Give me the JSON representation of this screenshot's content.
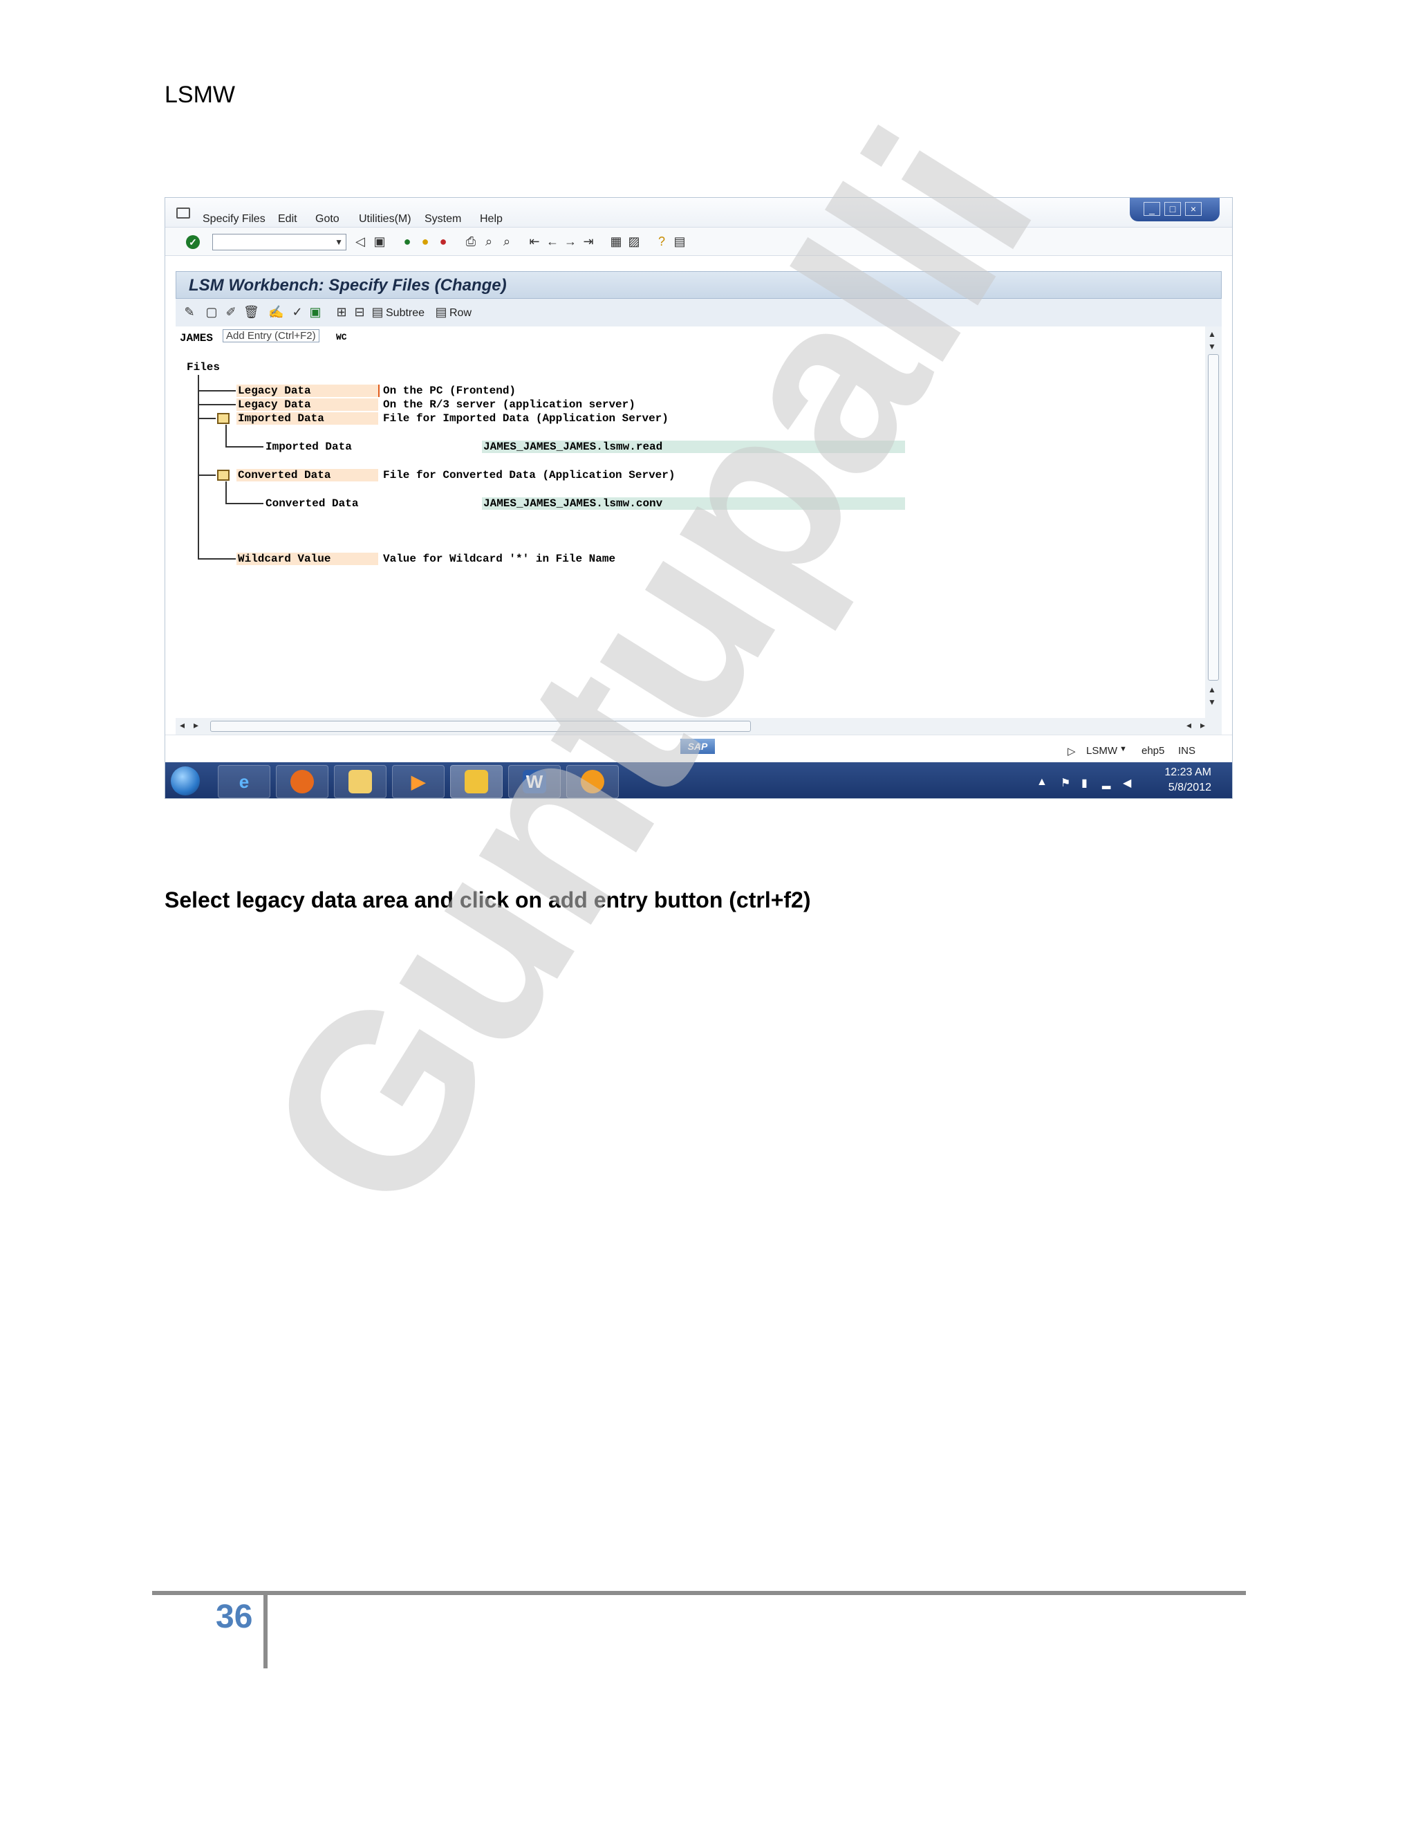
{
  "page": {
    "header": "LSMW",
    "instruction": "Select legacy data area and click on add entry button (ctrl+f2)",
    "page_number": "36",
    "watermark": "Guntupalli"
  },
  "sap": {
    "menu": [
      "Specify Files",
      "Edit",
      "Goto",
      "Utilities(M)",
      "System",
      "Help"
    ],
    "title": "LSM Workbench: Specify Files (Change)",
    "toolbar2": {
      "subtree_label": "Subtree",
      "row_label": "Row"
    },
    "header_left": "JAMES",
    "header_right": "WC",
    "tooltip": "Add Entry  (Ctrl+F2)",
    "files_heading": "Files",
    "tree": {
      "legacy_pc_label": "Legacy Data",
      "legacy_pc_desc": "On the PC (Frontend)",
      "legacy_server_label": "Legacy Data",
      "legacy_server_desc": "On the R/3 server (application server)",
      "imported_label": "Imported Data",
      "imported_desc": "File for Imported Data (Application Server)",
      "imported_child_label": "Imported Data",
      "imported_child_value": "JAMES_JAMES_JAMES.lsmw.read",
      "converted_label": "Converted Data",
      "converted_desc": "File for Converted Data (Application Server)",
      "converted_child_label": "Converted Data",
      "converted_child_value": "JAMES_JAMES_JAMES.lsmw.conv",
      "wildcard_label": "Wildcard Value",
      "wildcard_desc": "Value for Wildcard '*' in File Name"
    },
    "status": {
      "sap_logo": "SAP",
      "transaction": "LSMW",
      "system": "ehp5",
      "mode": "INS"
    },
    "taskbar": {
      "time": "12:23 AM",
      "date": "5/8/2012"
    }
  }
}
